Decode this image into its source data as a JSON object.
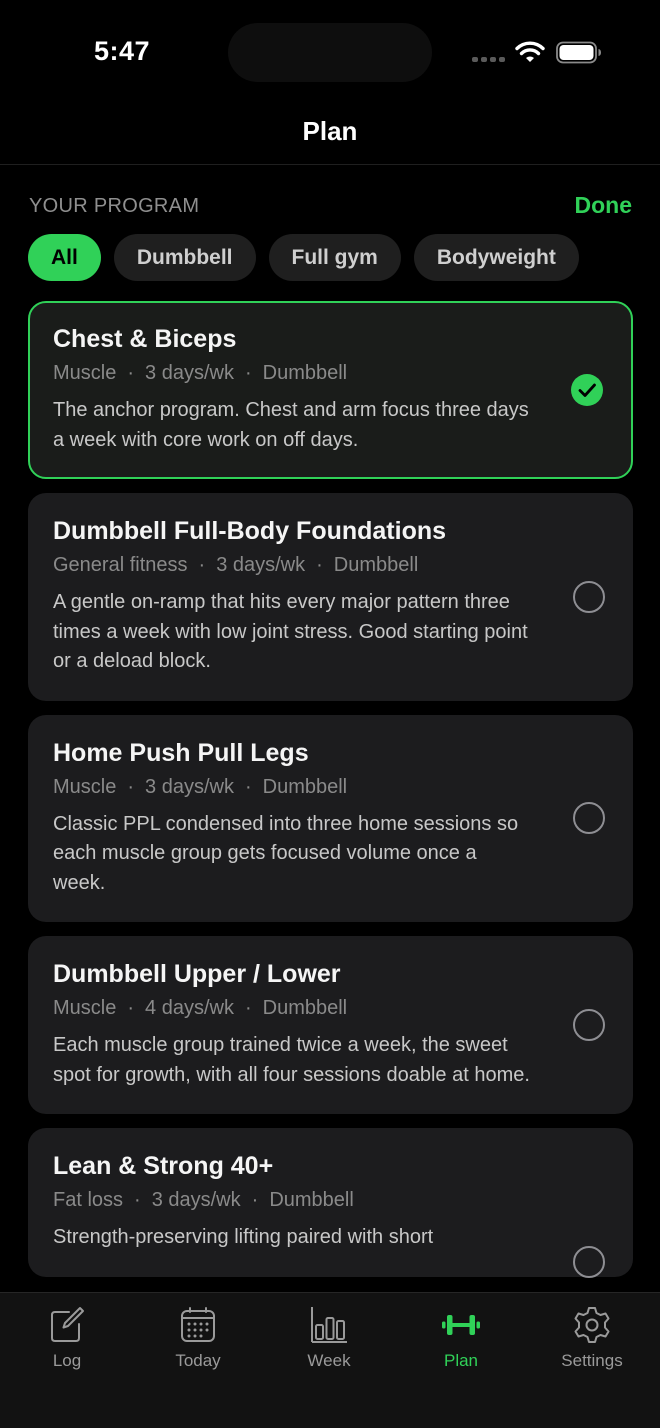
{
  "status_bar": {
    "time": "5:47"
  },
  "nav": {
    "title": "Plan"
  },
  "section": {
    "label": "YOUR PROGRAM",
    "done_label": "Done"
  },
  "filters": [
    {
      "label": "All",
      "active": true
    },
    {
      "label": "Dumbbell",
      "active": false
    },
    {
      "label": "Full gym",
      "active": false
    },
    {
      "label": "Bodyweight",
      "active": false
    }
  ],
  "programs": [
    {
      "title": "Chest & Biceps",
      "goal": "Muscle",
      "frequency": "3 days/wk",
      "equipment": "Dumbbell",
      "description": "The anchor program. Chest and arm focus three days a week with core work on off days.",
      "selected": true
    },
    {
      "title": "Dumbbell Full-Body Foundations",
      "goal": "General fitness",
      "frequency": "3 days/wk",
      "equipment": "Dumbbell",
      "description": "A gentle on-ramp that hits every major pattern three times a week with low joint stress. Good starting point or a deload block.",
      "selected": false
    },
    {
      "title": "Home Push Pull Legs",
      "goal": "Muscle",
      "frequency": "3 days/wk",
      "equipment": "Dumbbell",
      "description": "Classic PPL condensed into three home sessions so each muscle group gets focused volume once a week.",
      "selected": false
    },
    {
      "title": "Dumbbell Upper / Lower",
      "goal": "Muscle",
      "frequency": "4 days/wk",
      "equipment": "Dumbbell",
      "description": "Each muscle group trained twice a week, the sweet spot for growth, with all four sessions doable at home.",
      "selected": false
    },
    {
      "title": "Lean & Strong 40+",
      "goal": "Fat loss",
      "frequency": "3 days/wk",
      "equipment": "Dumbbell",
      "description": "Strength-preserving lifting paired with short",
      "selected": false
    }
  ],
  "meta_separator": "·",
  "tabs": [
    {
      "label": "Log",
      "icon": "edit-icon",
      "active": false
    },
    {
      "label": "Today",
      "icon": "calendar-icon",
      "active": false
    },
    {
      "label": "Week",
      "icon": "bar-chart-icon",
      "active": false
    },
    {
      "label": "Plan",
      "icon": "dumbbell-icon",
      "active": true
    },
    {
      "label": "Settings",
      "icon": "gear-icon",
      "active": false
    }
  ],
  "colors": {
    "accent": "#30d158",
    "background": "#000000",
    "card": "#1c1c1e"
  }
}
